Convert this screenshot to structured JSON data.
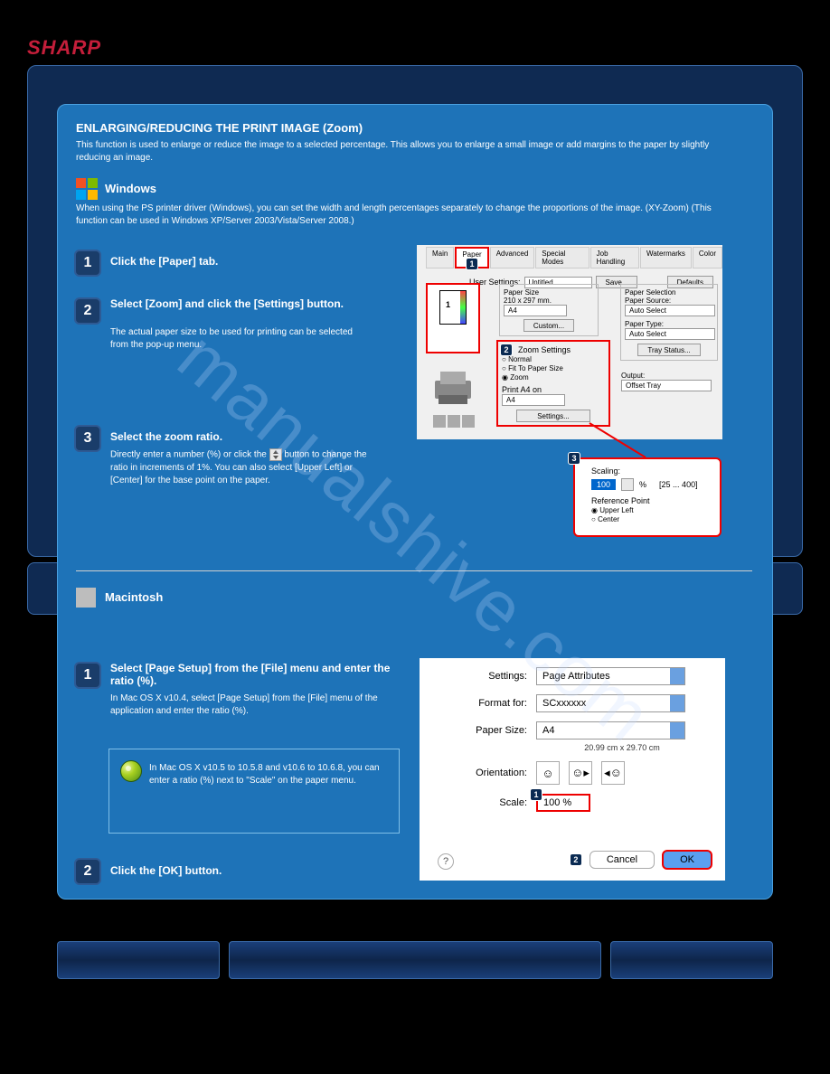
{
  "brand": "SHARP",
  "watermark": "manualshive.com",
  "heading": "ENLARGING/REDUCING THE PRINT IMAGE (Zoom)",
  "intro": "This function is used to enlarge or reduce the image to a selected percentage. This allows you to enlarge a small image or add margins to the paper by slightly reducing an image.",
  "ps_note": "When using the PS printer driver (Windows), you can set the width and length percentages separately to change the proportions of the image. (XY-Zoom)",
  "windows": {
    "title": "Windows",
    "ps_note_ext": "(This function can be used in Windows XP/Server 2003/Vista/Server 2008.)",
    "steps": {
      "1": {
        "heading": "Click the [Paper] tab."
      },
      "2": {
        "heading": "Select [Zoom] and click the [Settings] button.",
        "body": "The actual paper size to be used for printing can be selected from the pop-up menu."
      },
      "3": {
        "heading": "Select the zoom ratio.",
        "body_a": "Directly enter a number (%) or click the",
        "body_b": "button to change the ratio in increments of 1%. You can also select [Upper Left] or [Center] for the base point on the paper."
      }
    }
  },
  "mac": {
    "title": "Macintosh",
    "steps": {
      "1": {
        "heading": "Select [Page Setup] from the [File] menu and enter the ratio (%).",
        "body": "In Mac OS X v10.4, select [Page Setup] from the [File] menu of the application and enter the ratio (%)."
      },
      "2": {
        "heading": "Click the [OK] button."
      }
    },
    "tip": "In Mac OS X v10.5 to 10.5.8 and v10.6 to 10.6.8, you can enter a ratio (%) next to \"Scale\" on the paper menu."
  },
  "win_dialog": {
    "tabs": [
      "Main",
      "Paper",
      "Advanced",
      "Special Modes",
      "Job Handling",
      "Watermarks",
      "Color"
    ],
    "user_settings_label": "User Settings:",
    "user_settings_value": "Untitled",
    "save_btn": "Save...",
    "defaults_btn": "Defaults",
    "paper_size_label": "Paper Size",
    "paper_size_dims": "210 x 297 mm.",
    "paper_size_value": "A4",
    "custom_btn": "Custom...",
    "zoom_settings_label": "Zoom Settings",
    "radio_normal": "Normal",
    "radio_fit": "Fit To Paper Size",
    "radio_zoom": "Zoom",
    "print_on_label": "Print A4 on",
    "print_on_value": "A4",
    "settings_btn": "Settings...",
    "paper_selection_label": "Paper Selection",
    "paper_source_label": "Paper Source:",
    "paper_source_value": "Auto Select",
    "paper_type_label": "Paper Type:",
    "paper_type_value": "Auto Select",
    "tray_status_btn": "Tray Status...",
    "output_label": "Output:",
    "output_value": "Offset Tray",
    "scaling_label": "Scaling:",
    "scaling_value": "100",
    "scaling_unit": "%",
    "scaling_range": "[25 ... 400]",
    "ref_point_label": "Reference Point",
    "ref_upper_left": "Upper Left",
    "ref_center": "Center"
  },
  "mac_dialog": {
    "settings_label": "Settings:",
    "settings_value": "Page Attributes",
    "format_label": "Format for:",
    "format_value": "SCxxxxxx",
    "paper_size_label": "Paper Size:",
    "paper_size_value": "A4",
    "paper_dims": "20.99 cm x 29.70 cm",
    "orientation_label": "Orientation:",
    "scale_label": "Scale:",
    "scale_value": "100 %",
    "cancel_btn": "Cancel",
    "ok_btn": "OK"
  }
}
